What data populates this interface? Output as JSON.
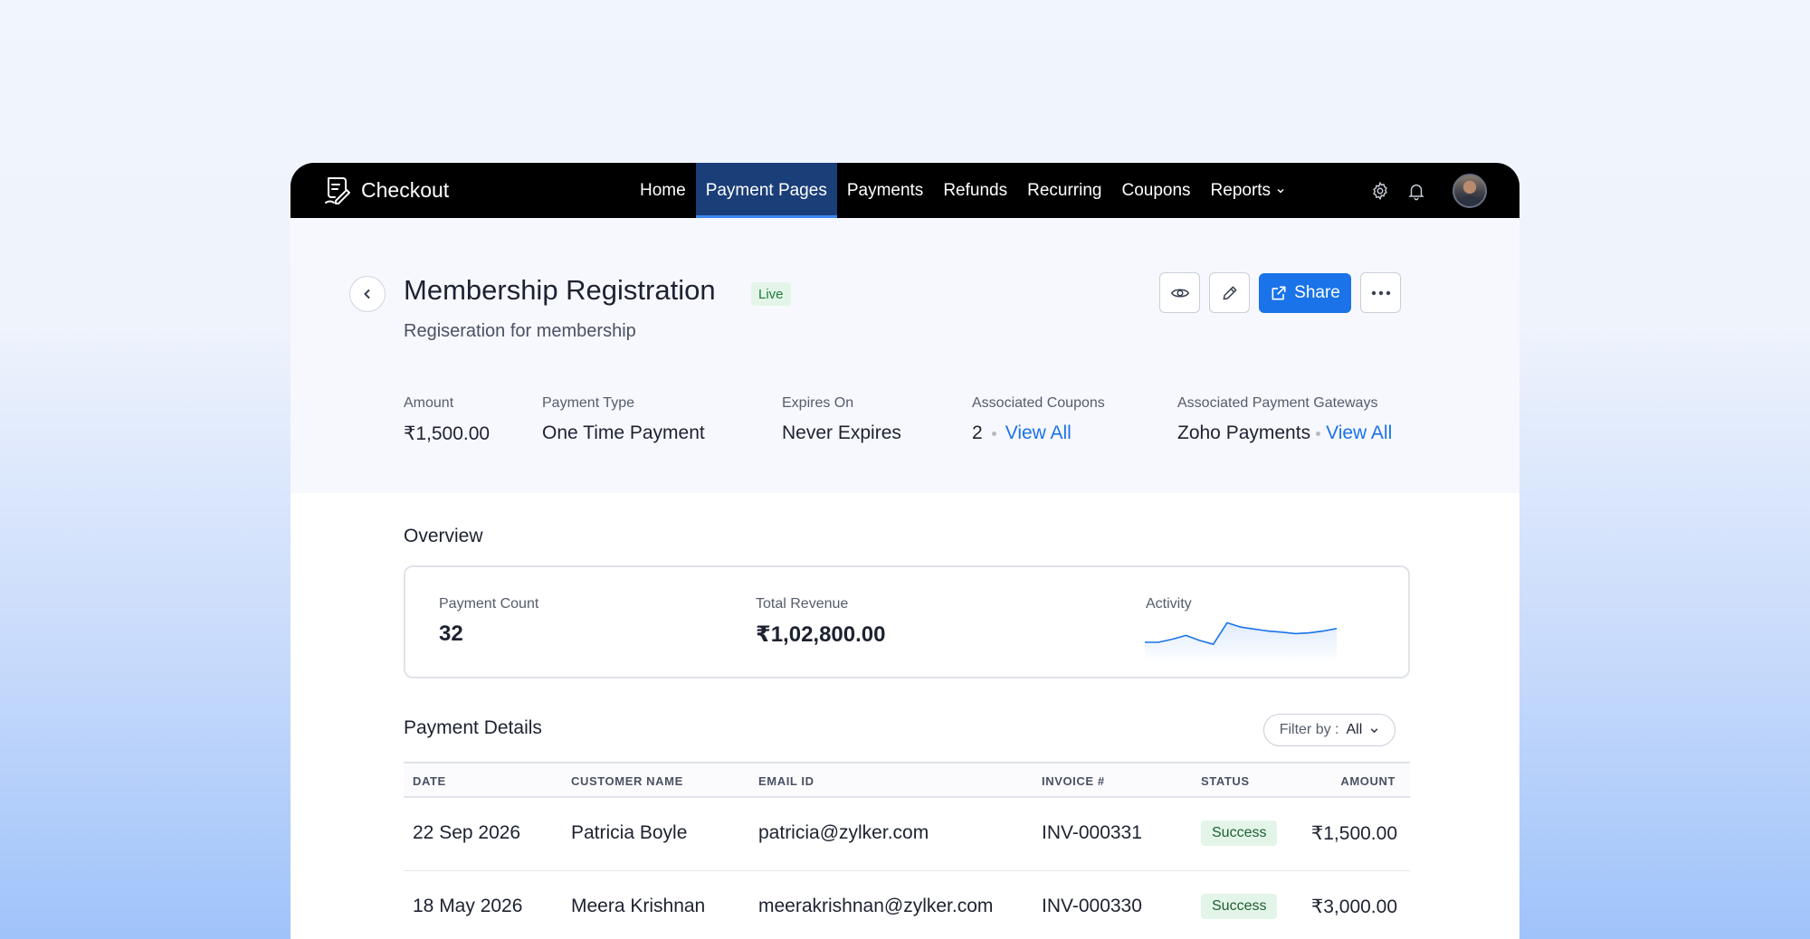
{
  "app": {
    "name": "Checkout"
  },
  "nav": {
    "items": [
      {
        "label": "Home",
        "active": false
      },
      {
        "label": "Payment Pages",
        "active": true
      },
      {
        "label": "Payments",
        "active": false
      },
      {
        "label": "Refunds",
        "active": false
      },
      {
        "label": "Recurring",
        "active": false
      },
      {
        "label": "Coupons",
        "active": false
      },
      {
        "label": "Reports",
        "active": false,
        "has_dropdown": true
      }
    ],
    "icons": [
      "gear-icon",
      "bell-icon"
    ]
  },
  "page": {
    "title": "Membership Registration",
    "status": "Live",
    "subtitle": "Regiseration for membership",
    "actions": {
      "preview_icon": "eye-icon",
      "edit_icon": "pencil-icon",
      "share_label": "Share",
      "more_icon": "more-horizontal-icon"
    }
  },
  "meta": {
    "amount": {
      "label": "Amount",
      "value": "₹1,500.00"
    },
    "payment_type": {
      "label": "Payment Type",
      "value": "One Time Payment"
    },
    "expires_on": {
      "label": "Expires On",
      "value": "Never Expires"
    },
    "coupons": {
      "label": "Associated Coupons",
      "value": "2",
      "link": "View All"
    },
    "gateways": {
      "label": "Associated Payment Gateways",
      "value": "Zoho Payments",
      "link": "View All"
    }
  },
  "overview": {
    "title": "Overview",
    "payment_count": {
      "label": "Payment Count",
      "value": "32"
    },
    "total_revenue": {
      "label": "Total Revenue",
      "value": "₹1,02,800.00"
    },
    "activity": {
      "label": "Activity",
      "trend": [
        0.18,
        0.18,
        0.3,
        0.45,
        0.25,
        0.1,
        0.95,
        0.78,
        0.7,
        0.62,
        0.58,
        0.52,
        0.55,
        0.62,
        0.72
      ]
    }
  },
  "payment_details": {
    "title": "Payment Details",
    "filter": {
      "prefix": "Filter by :",
      "value": "All"
    },
    "columns": [
      "DATE",
      "CUSTOMER NAME",
      "EMAIL ID",
      "INVOICE #",
      "STATUS",
      "AMOUNT"
    ],
    "rows": [
      {
        "date": "22 Sep 2026",
        "customer": "Patricia Boyle",
        "email": "patricia@zylker.com",
        "invoice": "INV-000331",
        "status": "Success",
        "amount": "₹1,500.00"
      },
      {
        "date": "18 May 2026",
        "customer": "Meera Krishnan",
        "email": "meerakrishnan@zylker.com",
        "invoice": "INV-000330",
        "status": "Success",
        "amount": "₹3,000.00"
      }
    ]
  },
  "colors": {
    "accent": "#1a73e8",
    "nav_bg": "#000000",
    "nav_active": "#1a3e78",
    "success_bg": "#e3f5e8",
    "success_text": "#1f7a3a"
  }
}
